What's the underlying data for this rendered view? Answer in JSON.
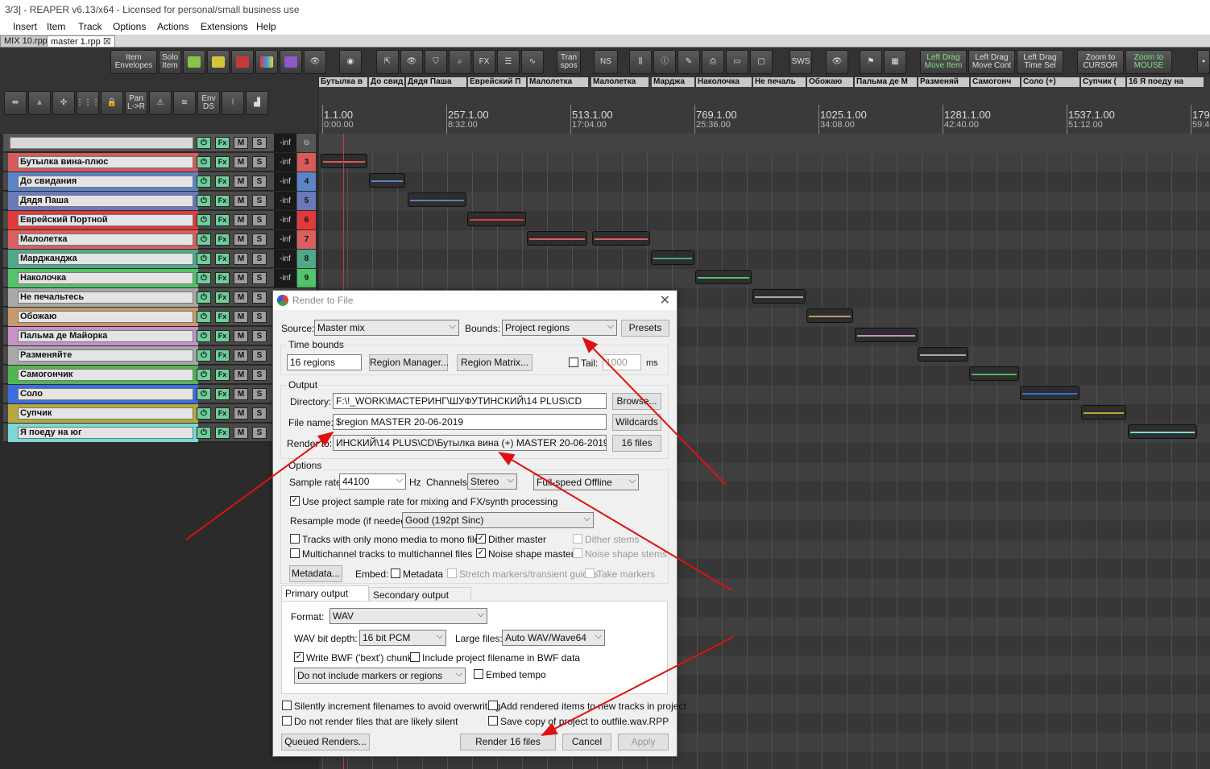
{
  "window": {
    "title": "3/3] - REAPER v6.13/x64 - Licensed for personal/small business use"
  },
  "menu": [
    "Insert",
    "Item",
    "Track",
    "Options",
    "Actions",
    "Extensions",
    "Help"
  ],
  "tabs": [
    "MIX 10.rpp",
    "master 1.rpp"
  ],
  "toolbar": {
    "item_envelopes": "Item\nEnvelopes",
    "solo_item": "Solo\nItem",
    "tran_spos": "Tran\nspos",
    "ns": "NS",
    "sws": "SWS",
    "left_drag_move_item": "Left Drag\nMove Item",
    "left_drag_move_cont": "Left Drag\nMove Cont",
    "left_drag_time_sel": "Left Drag\nTime Sel",
    "zoom_to_cursor": "Zoom to\nCURSOR",
    "zoom_to_mouse": "Zoom to\nMOUSE",
    "pan_lr": "Pan\nL->R",
    "env_ds": "Env\nDS"
  },
  "master": {
    "volume": "-inf"
  },
  "regions": [
    "Бутылка в",
    "До свид",
    "Дядя Паша",
    "Еврейский П",
    "Малолетка",
    "Малолетка",
    "Марджа",
    "Наколочка",
    "Не печаль",
    "Обожаю",
    "Пальма де М",
    "Разменяй",
    "Самогонч",
    "Соло (+)",
    "Супчик (",
    "16  Я поеду на"
  ],
  "ruler": [
    {
      "bar": "1.1.00",
      "time": "0:00.00"
    },
    {
      "bar": "257.1.00",
      "time": "8:32.00"
    },
    {
      "bar": "513.1.00",
      "time": "17:04.00"
    },
    {
      "bar": "769.1.00",
      "time": "25:36.00"
    },
    {
      "bar": "1025.1.00",
      "time": "34:08.00"
    },
    {
      "bar": "1281.1.00",
      "time": "42:40.00"
    },
    {
      "bar": "1537.1.00",
      "time": "51:12.00"
    },
    {
      "bar": "179",
      "time": "59:4"
    }
  ],
  "tracks": [
    {
      "name": "Бутылка вина-плюс",
      "vol": "-inf",
      "num": "3",
      "color": "#d85a5a"
    },
    {
      "name": "До свидания",
      "vol": "-inf",
      "num": "4",
      "color": "#5a86c8"
    },
    {
      "name": "Дядя Паша",
      "vol": "-inf",
      "num": "5",
      "color": "#6a7ab8"
    },
    {
      "name": "Еврейский Портной",
      "vol": "-inf",
      "num": "6",
      "color": "#e03a3a"
    },
    {
      "name": "Малолетка",
      "vol": "-inf",
      "num": "7",
      "color": "#d86060"
    },
    {
      "name": "Марджанджа",
      "vol": "-inf",
      "num": "8",
      "color": "#4fa88a"
    },
    {
      "name": "Наколочка",
      "vol": "-inf",
      "num": "9",
      "color": "#52c46a"
    },
    {
      "name": "Не печальтесь",
      "vol": "",
      "num": "",
      "color": "#a8a8a8"
    },
    {
      "name": "Обожаю",
      "vol": "",
      "num": "",
      "color": "#c89a6a"
    },
    {
      "name": "Пальма де Майорка",
      "vol": "",
      "num": "",
      "color": "#c890c8"
    },
    {
      "name": "Разменяйте",
      "vol": "",
      "num": "",
      "color": "#a8a8a8"
    },
    {
      "name": "Самогончик",
      "vol": "",
      "num": "",
      "color": "#52b452"
    },
    {
      "name": "Соло",
      "vol": "",
      "num": "",
      "color": "#3a6ee0"
    },
    {
      "name": "Супчик",
      "vol": "",
      "num": "",
      "color": "#b8a83a"
    },
    {
      "name": "Я поеду на юг",
      "vol": "",
      "num": "",
      "color": "#7ad8d8"
    }
  ],
  "track_buttons": {
    "fx": "Fx",
    "mute": "M",
    "solo": "S"
  },
  "render": {
    "title": "Render to File",
    "source_label": "Source:",
    "source_value": "Master mix",
    "bounds_label": "Bounds:",
    "bounds_value": "Project regions",
    "presets": "Presets",
    "time_bounds_group": "Time bounds",
    "regions_count": "16 regions",
    "region_manager": "Region Manager...",
    "region_matrix": "Region Matrix...",
    "tail_label": "Tail:",
    "tail_value": "1000",
    "tail_unit": "ms",
    "output_group": "Output",
    "directory_label": "Directory:",
    "directory_value": "F:\\!_WORK\\МАСТЕРИНГ\\ШУФУТИНСКИЙ\\14 PLUS\\CD",
    "browse": "Browse...",
    "filename_label": "File name:",
    "filename_value": "$region MASTER 20-06-2019",
    "wildcards": "Wildcards",
    "render_to_label": "Render to:",
    "render_to_value": "ИНСКИЙ\\14 PLUS\\CD\\Бутылка вина (+) MASTER 20-06-2019.wav",
    "files_count": "16 files",
    "options_group": "Options",
    "sample_rate_label": "Sample rate:",
    "sample_rate_value": "44100",
    "hz": "Hz",
    "channels_label": "Channels:",
    "channels_value": "Stereo",
    "speed_value": "Full-speed Offline",
    "use_project_rate": "Use project sample rate for mixing and FX/synth processing",
    "resample_label": "Resample mode (if needed):",
    "resample_value": "Good (192pt Sinc)",
    "mono_tracks": "Tracks with only mono media to mono file",
    "dither_master": "Dither master",
    "dither_stems": "Dither stems",
    "multichannel": "Multichannel tracks to multichannel files",
    "noise_master": "Noise shape master",
    "noise_stems": "Noise shape stems",
    "metadata_btn": "Metadata...",
    "embed_label": "Embed:",
    "metadata_cb": "Metadata",
    "stretch_markers": "Stretch markers/transient guides",
    "take_markers": "Take markers",
    "primary_tab": "Primary output format",
    "secondary_tab": "Secondary output format",
    "format_label": "Format:",
    "format_value": "WAV",
    "bit_depth_label": "WAV bit depth:",
    "bit_depth_value": "16 bit PCM",
    "large_files_label": "Large files:",
    "large_files_value": "Auto WAV/Wave64",
    "write_bwf": "Write BWF ('bext') chunk",
    "include_filename": "Include project filename in BWF data",
    "markers_value": "Do not include markers or regions",
    "embed_tempo": "Embed tempo",
    "silently_increment": "Silently increment filenames to avoid overwriting",
    "add_rendered": "Add rendered items to new tracks in project",
    "dont_render_silent": "Do not render files that are likely silent",
    "save_copy": "Save copy of project to outfile.wav.RPP",
    "queued_renders": "Queued Renders...",
    "render_btn": "Render 16 files",
    "cancel": "Cancel",
    "apply": "Apply"
  }
}
